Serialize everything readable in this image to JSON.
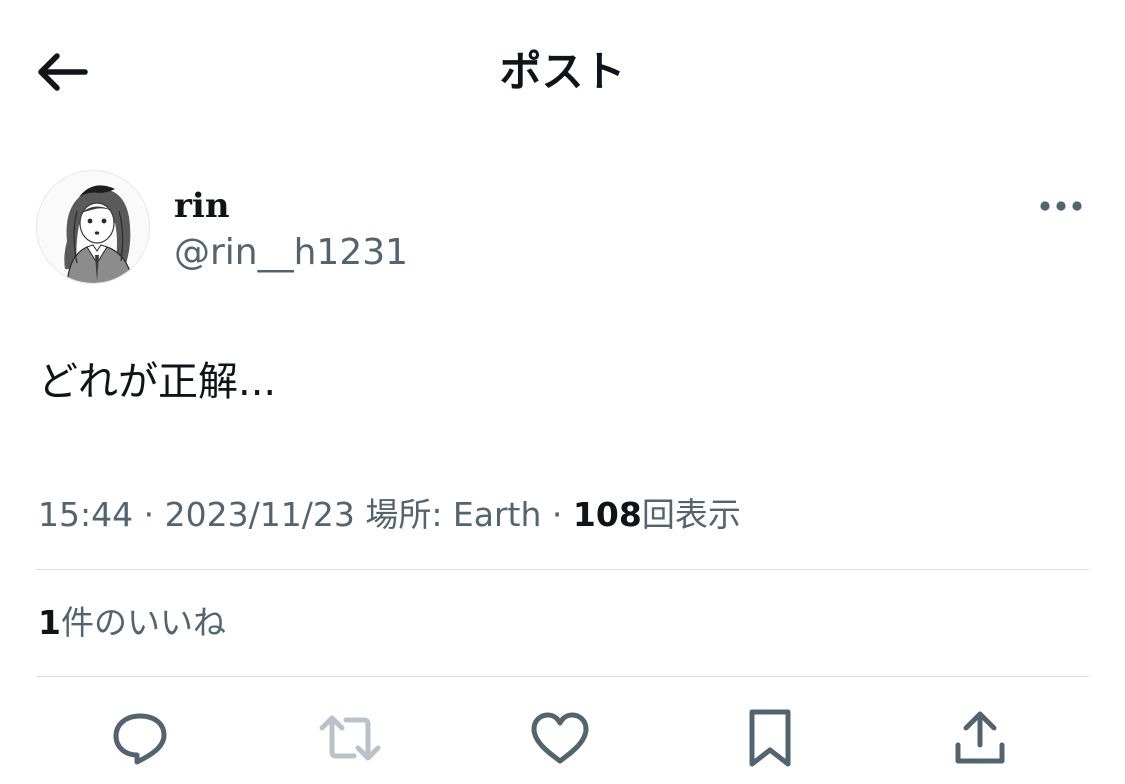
{
  "header": {
    "title": "ポスト",
    "back_icon": "arrow-left-icon"
  },
  "author": {
    "display_name": "rin",
    "handle": "@rin__h1231",
    "avatar_icon": "avatar-illustration",
    "more_icon": "more-horizontal-icon"
  },
  "post": {
    "text": "どれが正解..."
  },
  "meta": {
    "time": "15:44",
    "separator": "·",
    "date": "2023/11/23",
    "location_label": "場所: Earth",
    "views_count": "108",
    "views_label": "回表示"
  },
  "likes": {
    "count": "1",
    "label": "件のいいね"
  },
  "actions": {
    "icons": [
      "reply-icon",
      "repost-icon",
      "like-icon",
      "bookmark-icon",
      "share-icon"
    ],
    "repost_disabled": true
  },
  "colors": {
    "text_primary": "#0f1419",
    "text_secondary": "#536471",
    "divider": "#d8dee2",
    "disabled": "#b9c2ca"
  }
}
